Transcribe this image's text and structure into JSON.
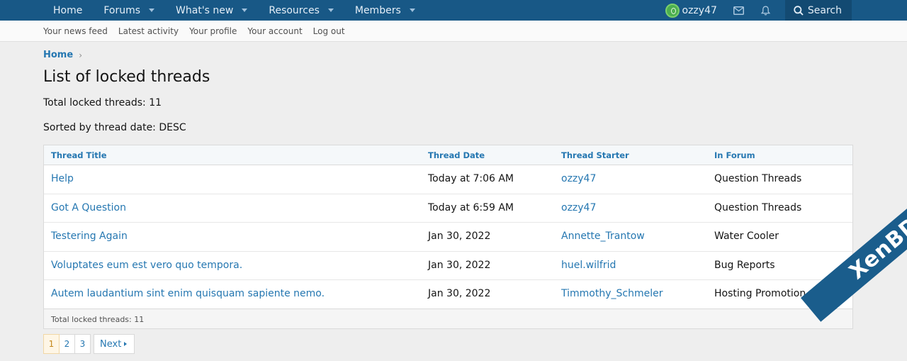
{
  "topnav": {
    "items": [
      {
        "label": "Home",
        "has_caret": false
      },
      {
        "label": "Forums",
        "has_caret": true
      },
      {
        "label": "What's new",
        "has_caret": true
      },
      {
        "label": "Resources",
        "has_caret": true
      },
      {
        "label": "Members",
        "has_caret": true
      }
    ],
    "username": "ozzy47",
    "search_label": "Search"
  },
  "subnav": {
    "items": [
      "Your news feed",
      "Latest activity",
      "Your profile",
      "Your account",
      "Log out"
    ]
  },
  "breadcrumb": {
    "home": "Home",
    "sep": "›"
  },
  "page": {
    "title": "List of locked threads",
    "total_line": "Total locked threads: 11",
    "sorted_line": "Sorted by thread date: DESC"
  },
  "table": {
    "headers": [
      "Thread Title",
      "Thread Date",
      "Thread Starter",
      "In Forum"
    ],
    "rows": [
      [
        "Help",
        "Today at 7:06 AM",
        "ozzy47",
        "Question Threads"
      ],
      [
        "Got A Question",
        "Today at 6:59 AM",
        "ozzy47",
        "Question Threads"
      ],
      [
        "Testering Again",
        "Jan 30, 2022",
        "Annette_Trantow",
        "Water Cooler"
      ],
      [
        "Voluptates eum est vero quo tempora.",
        "Jan 30, 2022",
        "huel.wilfrid",
        "Bug Reports"
      ],
      [
        "Autem laudantium sint enim quisquam sapiente nemo.",
        "Jan 30, 2022",
        "Timmothy_Schmeler",
        "Hosting Promotion"
      ]
    ],
    "footer": "Total locked threads: 11"
  },
  "pager": {
    "pages": [
      "1",
      "2",
      "3"
    ],
    "current": "1",
    "next_label": "Next"
  },
  "watermark": "XenBD.Com",
  "colors": {
    "nav_bg": "#185886",
    "link": "#2577b1",
    "avatar": "#4caf50"
  }
}
